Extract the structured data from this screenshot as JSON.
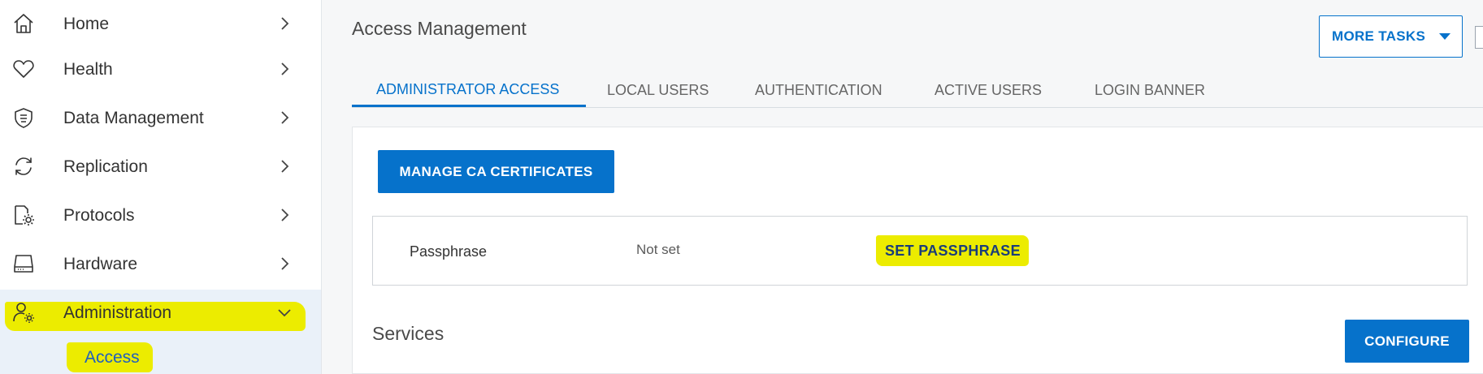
{
  "sidebar": {
    "items": [
      {
        "label": "Home",
        "icon": "home-icon"
      },
      {
        "label": "Health",
        "icon": "heart-icon"
      },
      {
        "label": "Data Management",
        "icon": "shield-icon"
      },
      {
        "label": "Replication",
        "icon": "sync-icon"
      },
      {
        "label": "Protocols",
        "icon": "protocols-gear-icon"
      },
      {
        "label": "Hardware",
        "icon": "drive-icon"
      },
      {
        "label": "Administration",
        "icon": "user-gear-icon",
        "expanded": true
      }
    ],
    "sub_items": [
      {
        "label": "Access",
        "selected": true
      }
    ]
  },
  "header": {
    "title": "Access Management",
    "more_tasks_label": "MORE TASKS"
  },
  "tabs": [
    {
      "label": "ADMINISTRATOR ACCESS",
      "active": true
    },
    {
      "label": "LOCAL USERS"
    },
    {
      "label": "AUTHENTICATION"
    },
    {
      "label": "ACTIVE USERS"
    },
    {
      "label": "LOGIN BANNER"
    }
  ],
  "content": {
    "manage_ca_label": "MANAGE CA CERTIFICATES",
    "passphrase": {
      "label": "Passphrase",
      "value": "Not set",
      "action_label": "SET PASSPHRASE"
    },
    "services": {
      "title": "Services",
      "configure_label": "CONFIGURE"
    }
  },
  "colors": {
    "accent": "#0672cb",
    "highlight": "#ecec00",
    "selected_bg": "#eaf1f9"
  }
}
